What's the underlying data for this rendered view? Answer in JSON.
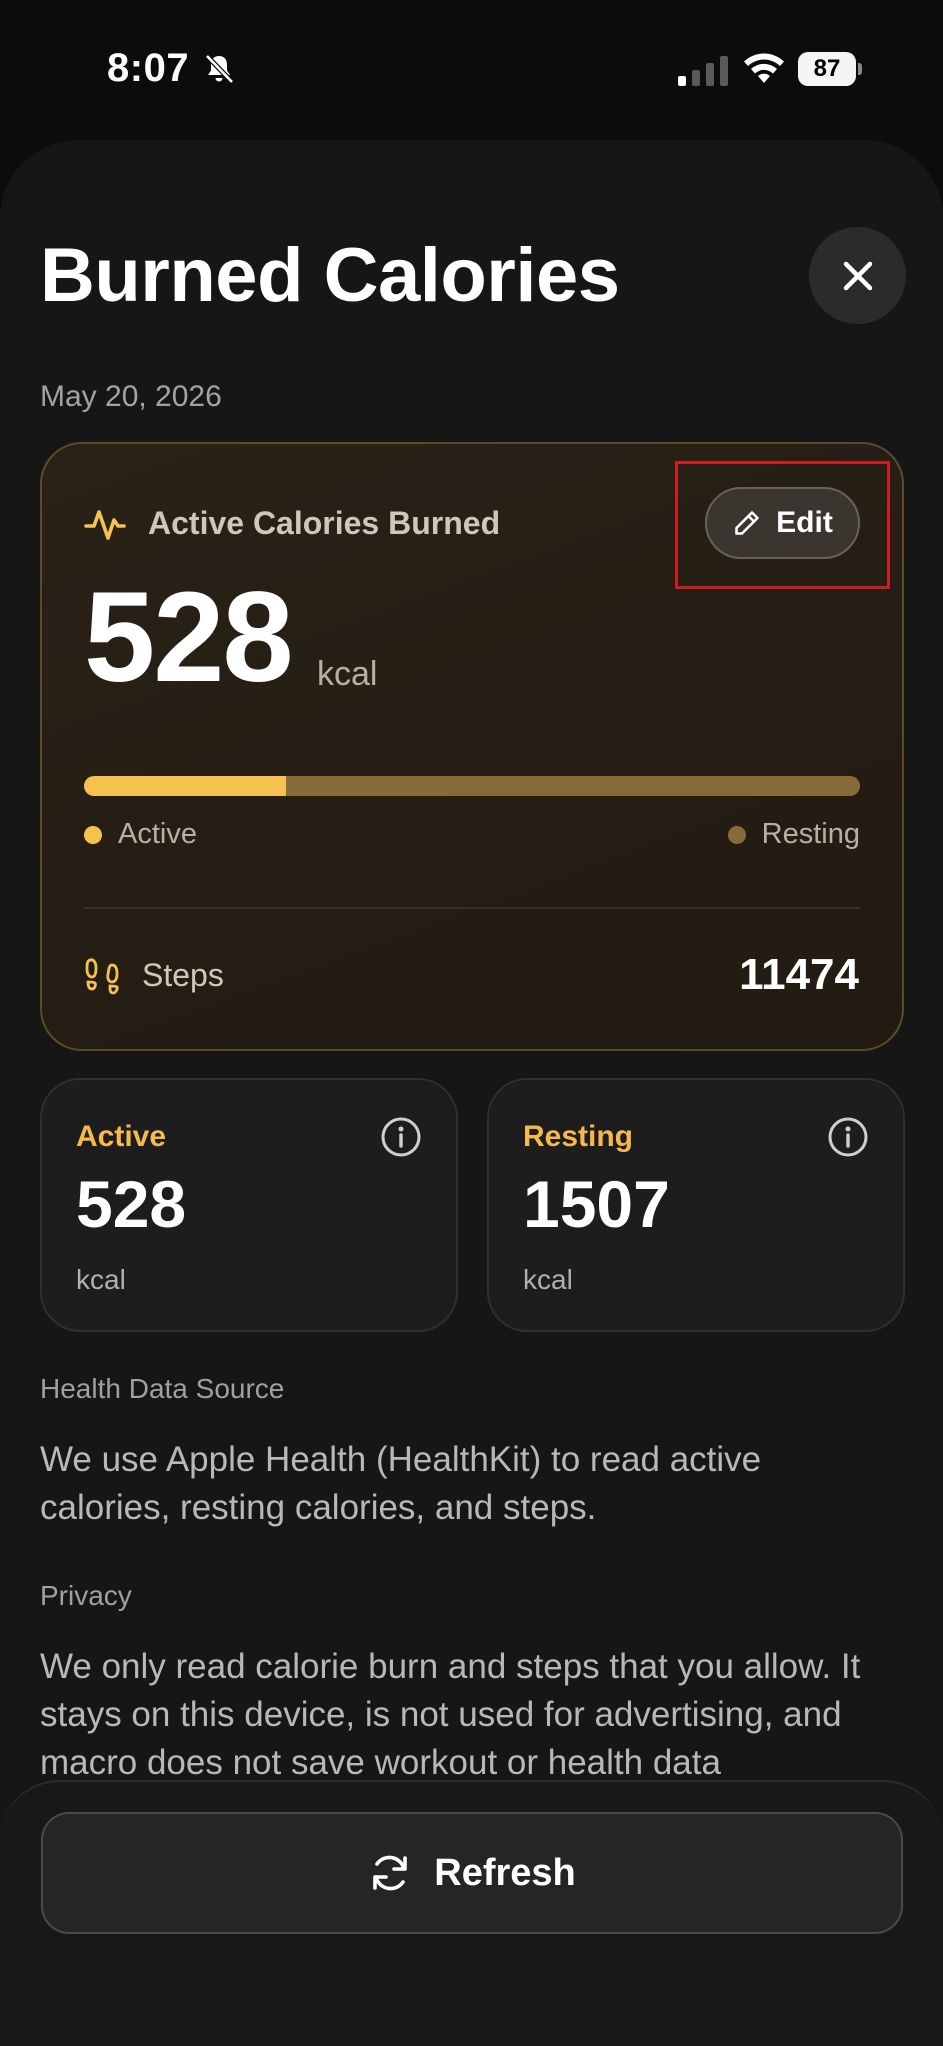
{
  "status_bar": {
    "time": "8:07",
    "battery": "87"
  },
  "header": {
    "title": "Burned Calories"
  },
  "date": "May 20, 2026",
  "main_card": {
    "label": "Active Calories Burned",
    "edit_label": "Edit",
    "value": "528",
    "unit": "kcal",
    "active_fraction": 0.26,
    "legend_active": "Active",
    "legend_resting": "Resting",
    "steps_label": "Steps",
    "steps_value": "11474"
  },
  "active_card": {
    "label": "Active",
    "value": "528",
    "unit": "kcal"
  },
  "resting_card": {
    "label": "Resting",
    "value": "1507",
    "unit": "kcal"
  },
  "sections": {
    "source_heading": "Health Data Source",
    "source_body": "We use Apple Health (HealthKit) to read active calories, resting calories, and steps.",
    "privacy_heading": "Privacy",
    "privacy_body": "We only read calorie burn and steps that you allow. It stays on this device, is not used for advertising, and macro does not save workout or health data"
  },
  "bottom": {
    "refresh_label": "Refresh"
  },
  "colors": {
    "accent": "#f6c24f",
    "resting": "#866a3a",
    "highlight": "#d11b22"
  }
}
